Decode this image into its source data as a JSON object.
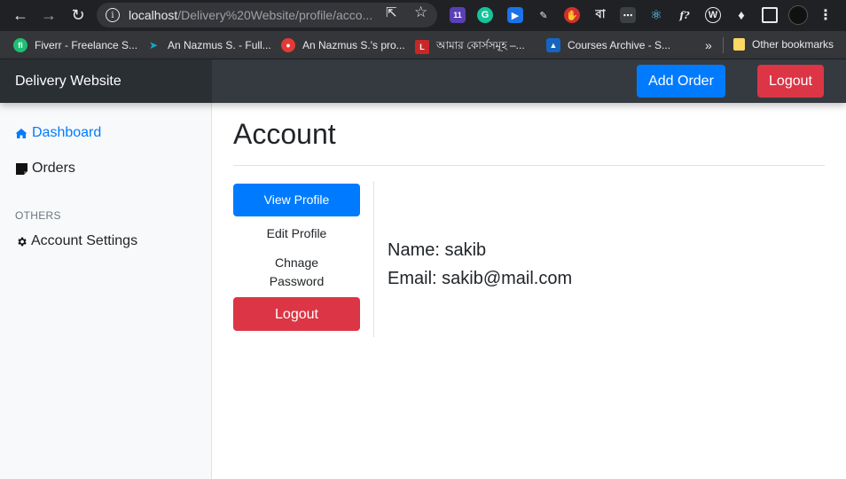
{
  "browser": {
    "url_host": "localhost",
    "url_path": "/Delivery%20Website/profile/acco...",
    "extension_badge": "11",
    "bookmarks": [
      {
        "label": "Fiverr - Freelance S...",
        "color": "#1dbf73",
        "icon": "fi"
      },
      {
        "label": "An Nazmus S. - Full...",
        "color": "#14a800",
        "icon": ""
      },
      {
        "label": "An Nazmus S.'s pro...",
        "color": "#e53935",
        "icon": ""
      },
      {
        "label": "আমার কোর্সসমূহ –...",
        "color": "#c62828",
        "icon": ""
      },
      {
        "label": "Courses Archive - S...",
        "color": "#1565c0",
        "icon": ""
      }
    ],
    "more_label": "»",
    "other_bookmarks": "Other bookmarks"
  },
  "header": {
    "brand": "Delivery Website",
    "add_order": "Add Order",
    "logout": "Logout"
  },
  "sidebar": {
    "dashboard": "Dashboard",
    "orders": "Orders",
    "others_heading": "OTHERS",
    "account_settings": "Account Settings"
  },
  "main": {
    "title": "Account",
    "pills": {
      "view_profile": "View Profile",
      "edit_profile": "Edit Profile",
      "change_password": "Chnage Password",
      "logout": "Logout"
    },
    "name_line": "Name: sakib",
    "email_line": "Email: sakib@mail.com"
  },
  "colors": {
    "primary": "#007bff",
    "danger": "#dc3545",
    "navbar": "#343a40",
    "sidebar_bg": "#f8f9fa"
  }
}
